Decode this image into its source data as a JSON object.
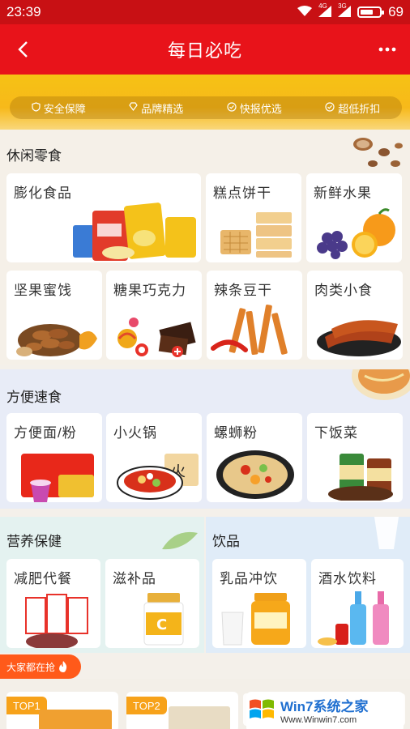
{
  "status": {
    "time": "23:39",
    "signal1": "4G",
    "signal2": "3G",
    "battery": "69",
    "battery_level": 0.69
  },
  "nav": {
    "title": "每日必吃"
  },
  "guarantees": [
    "安全保障",
    "品牌精选",
    "快报优选",
    "超低折扣"
  ],
  "sections": {
    "snacks": {
      "title": "休闲零食",
      "items": [
        "膨化食品",
        "糕点饼干",
        "新鲜水果",
        "坚果蜜饯",
        "糖果巧克力",
        "辣条豆干",
        "肉类小食"
      ]
    },
    "instant": {
      "title": "方便速食",
      "items": [
        "方便面/粉",
        "小火锅",
        "螺蛳粉",
        "下饭菜"
      ]
    },
    "health": {
      "title": "营养保健",
      "items": [
        "减肥代餐",
        "滋补品"
      ]
    },
    "drinks": {
      "title": "饮品",
      "items": [
        "乳品冲饮",
        "酒水饮料"
      ]
    }
  },
  "hot": {
    "label": "大家都在抢"
  },
  "tops": [
    "TOP1",
    "TOP2"
  ],
  "watermark": {
    "line1": "Win7系统之家",
    "line2": "Www.Winwin7.com"
  }
}
